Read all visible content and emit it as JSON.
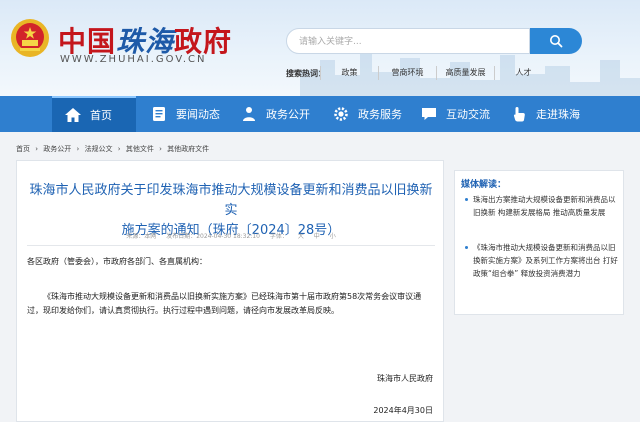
{
  "header": {
    "title_part1": "中国",
    "title_part2": "珠海",
    "title_part3": "政府",
    "domain": "WWW.ZHUHAI.GOV.CN",
    "search_placeholder": "请输入关键字...",
    "hot_label": "搜索热词：",
    "hot_words": [
      "政策",
      "营商环境",
      "高质量发展",
      "人才"
    ]
  },
  "nav": {
    "items": [
      {
        "label": "首页",
        "icon": "home-icon"
      },
      {
        "label": "要闻动态",
        "icon": "news-icon"
      },
      {
        "label": "政务公开",
        "icon": "people-icon"
      },
      {
        "label": "政务服务",
        "icon": "gear-icon"
      },
      {
        "label": "互动交流",
        "icon": "chat-icon"
      },
      {
        "label": "走进珠海",
        "icon": "hand-icon"
      }
    ]
  },
  "breadcrumb": [
    "首页",
    "›",
    "政务公开",
    "›",
    "法规公文",
    "›",
    "其他文件",
    "›",
    "其他政府文件"
  ],
  "article": {
    "title_line1": "珠海市人民政府关于印发珠海市推动大规模设备更新和消费品以旧换新实",
    "title_line2": "施方案的通知（珠府〔2024〕28号）",
    "meta_source": "来源：本网",
    "meta_date": "发布日期：2024-04-30 18:32:10",
    "meta_font": "字体：",
    "meta_large": "大",
    "meta_medium": "中",
    "meta_small": "小",
    "salutation": "各区政府（管委会），市政府各部门、各直属机构：",
    "paragraph": "《珠海市推动大规模设备更新和消费品以旧换新实施方案》已经珠海市第十届市政府第58次常务会议审议通过，现印发给你们，请认真贯彻执行。执行过程中遇到问题，请径向市发展改革局反映。",
    "signatory": "珠海市人民政府",
    "sign_date": "2024年4月30日"
  },
  "sidebar": {
    "title": "媒体解读：",
    "items": [
      "珠海出方案推动大规模设备更新和消费品以旧换新 构建新发展格局 推动高质量发展",
      "《珠海市推动大规模设备更新和消费品以旧换新实施方案》及系列工作方案将出台 打好政策“组合拳” 释放投资消费潜力"
    ]
  },
  "colors": {
    "nav_bg": "#2f7fcf",
    "nav_active": "#1a66b3",
    "title_red": "#c4161c",
    "link_blue": "#1f62b3"
  }
}
